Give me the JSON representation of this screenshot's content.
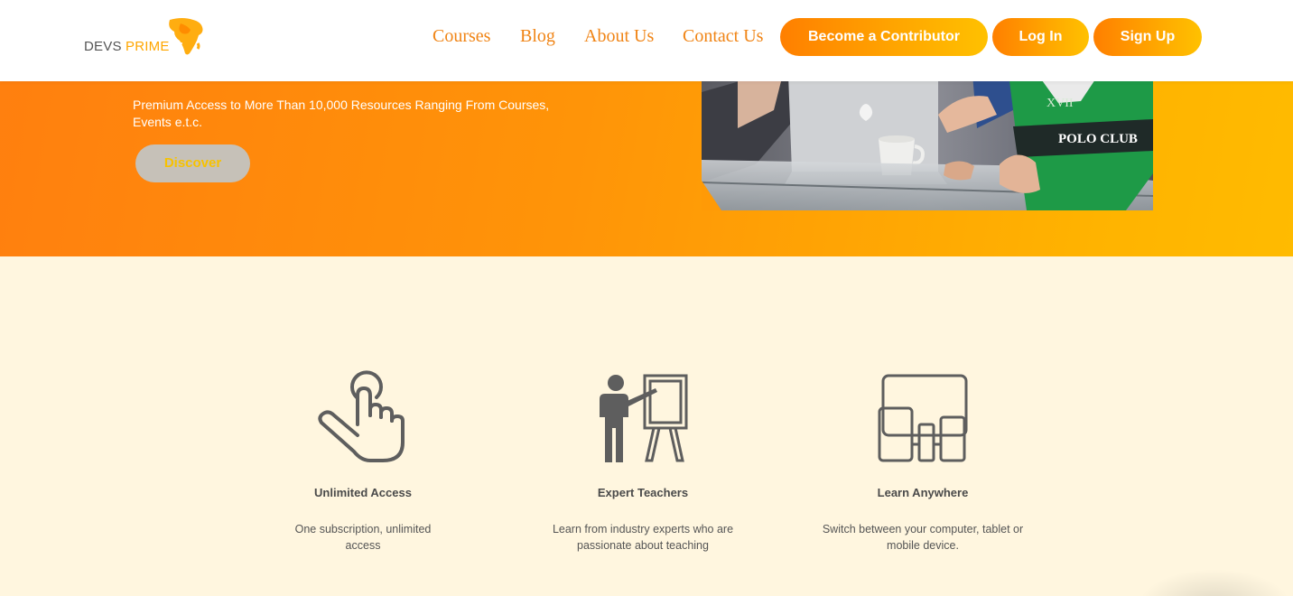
{
  "header": {
    "logo": {
      "word1": "DEVS",
      "word2": "PRIME"
    },
    "nav": [
      "Courses",
      "Blog",
      "About Us",
      "Contact Us"
    ],
    "buttons": {
      "contributor": "Become a Contributor",
      "login": "Log In",
      "signup": "Sign Up"
    }
  },
  "hero": {
    "subtitle": "Premium Access to More Than 10,000 Resources Ranging From Courses, Events e.t.c.",
    "cta": "Discover"
  },
  "features": [
    {
      "title": "Unlimited Access",
      "desc": "One subscription, unlimited access",
      "icon": "tap-hand-icon"
    },
    {
      "title": "Expert Teachers",
      "desc": "Learn from industry experts who are passionate about teaching",
      "icon": "teacher-board-icon"
    },
    {
      "title": "Learn Anywhere",
      "desc": "Switch between your computer, tablet or mobile device.",
      "icon": "devices-icon"
    }
  ],
  "colors": {
    "brand_orange": "#ff8a00",
    "brand_yellow": "#ffbb00",
    "nav_text": "#f08415",
    "page_bg": "#fff6df"
  }
}
